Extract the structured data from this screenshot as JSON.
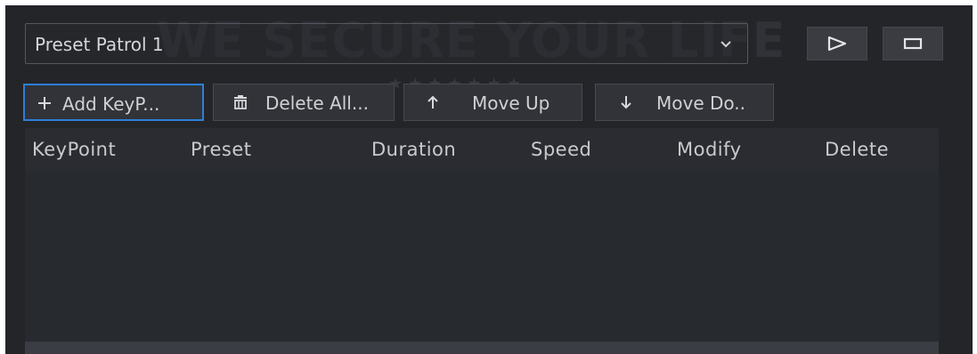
{
  "watermark": {
    "text": "WE SECURE YOUR LIFE",
    "stars": "★★★★★★★"
  },
  "patrol_select": {
    "value": "Preset Patrol 1",
    "chevron_icon": "chevron-down-icon"
  },
  "controls": {
    "play_icon": "play-outline-icon",
    "stop_icon": "stop-rectangle-icon"
  },
  "toolbar": {
    "add_label": "Add KeyP...",
    "add_icon": "plus-icon",
    "delete_all_label": "Delete All...",
    "delete_all_icon": "trash-icon",
    "move_up_label": "Move Up",
    "move_up_icon": "arrow-up-icon",
    "move_down_label": "Move Do..",
    "move_down_icon": "arrow-down-icon"
  },
  "table": {
    "columns": [
      "KeyPoint",
      "Preset",
      "Duration",
      "Speed",
      "Modify",
      "Delete"
    ],
    "rows": []
  },
  "colors": {
    "background": "#232529",
    "accent_border": "#2e7fd6",
    "text": "#d0d1d3"
  }
}
